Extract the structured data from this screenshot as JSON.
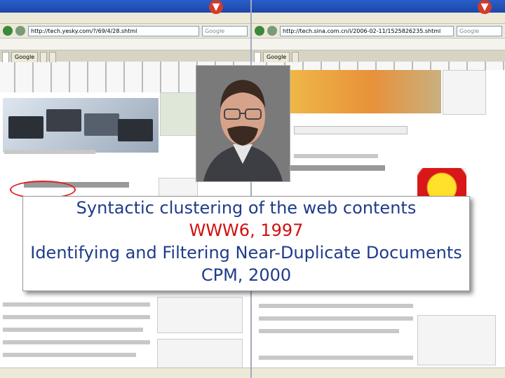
{
  "caption": {
    "line1": "Syntactic clustering of the web contents",
    "line2_red": "WWW6",
    "line2_rest": ", 1997",
    "line3": "Identifying and Filtering Near-Duplicate Documents",
    "line4": "CPM, 2000"
  },
  "left_window": {
    "address": "http://tech.yesky.com/?/69/4/28.shtml",
    "search_placeholder": "Google",
    "tab": "Google"
  },
  "right_window": {
    "address": "http://tech.sina.com.cn/i/2006-02-11/1525826235.shtml",
    "search_placeholder": "Google",
    "tab": "Google"
  },
  "colors": {
    "caption_blue": "#1f3c8a",
    "caption_red": "#d01010",
    "titlebar": "#2a5fc9"
  }
}
